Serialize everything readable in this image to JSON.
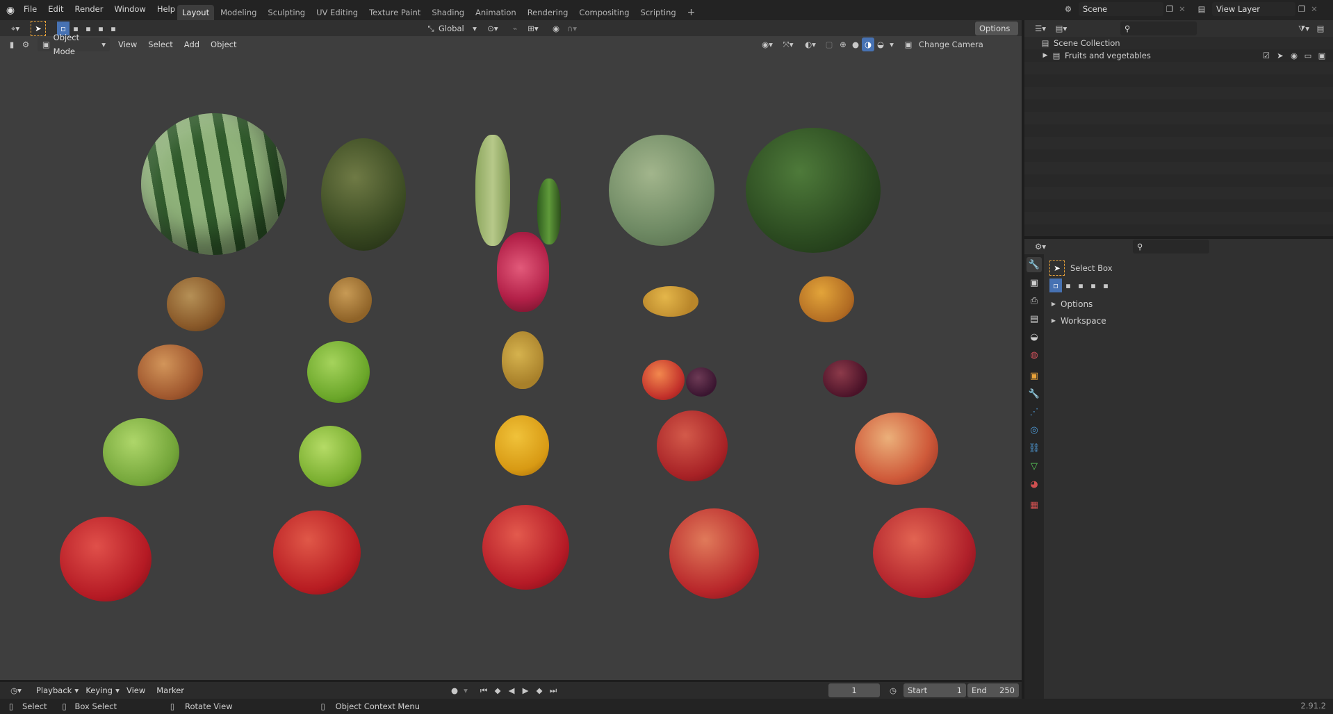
{
  "topbar": {
    "menus": [
      "File",
      "Edit",
      "Render",
      "Window",
      "Help"
    ],
    "workspaces": [
      "Layout",
      "Modeling",
      "Sculpting",
      "UV Editing",
      "Texture Paint",
      "Shading",
      "Animation",
      "Rendering",
      "Compositing",
      "Scripting"
    ],
    "active_workspace": "Layout",
    "add_tab": "+",
    "scene": "Scene",
    "view_layer": "View Layer"
  },
  "tool_header": {
    "orientation": "Global",
    "options": "Options"
  },
  "viewport_header": {
    "mode": "Object Mode",
    "menus": [
      "View",
      "Select",
      "Add",
      "Object"
    ],
    "change_camera": "Change Camera"
  },
  "outliner": {
    "root": "Scene Collection",
    "collection": "Fruits and vegetables"
  },
  "properties": {
    "tool_name": "Select Box",
    "panels": [
      "Options",
      "Workspace"
    ]
  },
  "timeline": {
    "menus": [
      "Playback",
      "Keying",
      "View",
      "Marker"
    ],
    "current_frame": "1",
    "start_label": "Start",
    "start": "1",
    "end_label": "End",
    "end": "250"
  },
  "status": {
    "select": "Select",
    "box_select": "Box Select",
    "rotate_view": "Rotate View",
    "context_menu": "Object Context Menu",
    "version": "2.91.2"
  },
  "colors": {
    "accent": "#4772b3",
    "viewport_bg": "#3e3e3e"
  }
}
